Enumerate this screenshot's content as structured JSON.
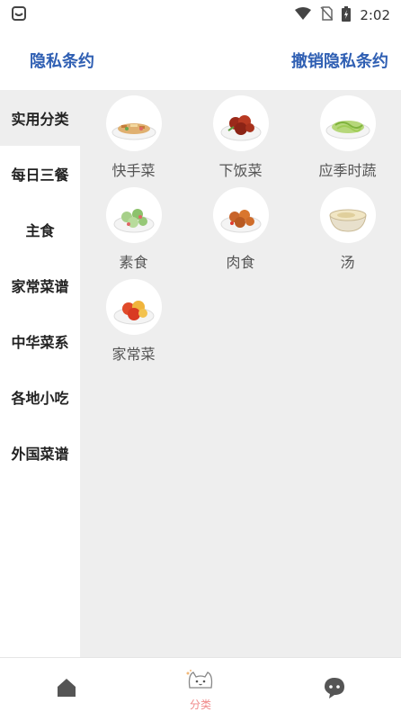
{
  "status": {
    "time": "2:02"
  },
  "header": {
    "privacy_label": "隐私条约",
    "revoke_label": "撤销隐私条约"
  },
  "sidebar": {
    "items": [
      {
        "label": "实用分类",
        "active": true
      },
      {
        "label": "每日三餐"
      },
      {
        "label": "主食"
      },
      {
        "label": "家常菜谱"
      },
      {
        "label": "中华菜系"
      },
      {
        "label": "各地小吃"
      },
      {
        "label": "外国菜谱"
      }
    ]
  },
  "categories": [
    {
      "label": "快手菜",
      "icon": "stir-fry-dish-image"
    },
    {
      "label": "下饭菜",
      "icon": "braised-pork-dish-image"
    },
    {
      "label": "应季时蔬",
      "icon": "green-vegetable-dish-image"
    },
    {
      "label": "素食",
      "icon": "cucumber-dish-image"
    },
    {
      "label": "肉食",
      "icon": "fried-meat-dish-image"
    },
    {
      "label": "汤",
      "icon": "soup-dish-image"
    },
    {
      "label": "家常菜",
      "icon": "tomato-egg-dish-image"
    }
  ],
  "tabbar": {
    "tabs": [
      {
        "icon": "home-icon"
      },
      {
        "icon": "cat-icon",
        "label": "分类",
        "active": true
      },
      {
        "icon": "chat-icon"
      }
    ]
  },
  "colors": {
    "accent": "#2f5fb3",
    "active_tab": "#f08a8a",
    "panel_bg": "#eeeeee"
  }
}
